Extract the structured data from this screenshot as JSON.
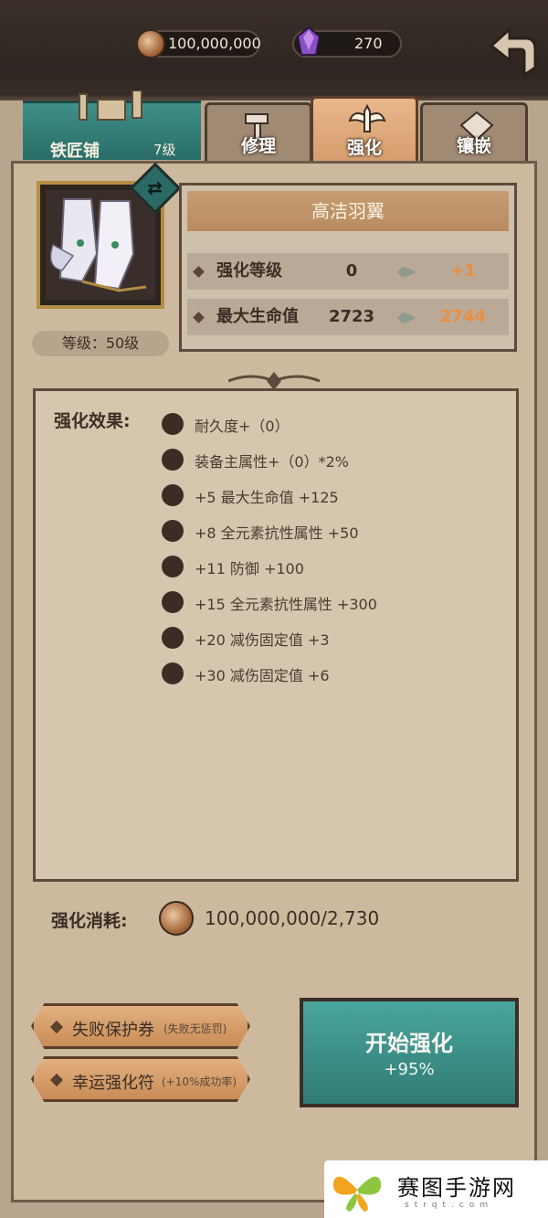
{
  "currency": {
    "gold": "100,000,000",
    "gold_icon": "coin-icon",
    "gem": "270",
    "gem_icon": "purple-gem-icon"
  },
  "shop": {
    "name": "铁匠铺",
    "level": "7级"
  },
  "tabs": [
    {
      "label": "修理",
      "icon": "hammer-icon",
      "active": false
    },
    {
      "label": "强化",
      "icon": "winged-sword-icon",
      "active": true
    },
    {
      "label": "镶嵌",
      "icon": "diamond-icon",
      "active": false
    }
  ],
  "item": {
    "name": "高洁羽翼",
    "level_text": "等级：50级",
    "stats": [
      {
        "label": "强化等级",
        "current": "0",
        "next": "+1"
      },
      {
        "label": "最大生命值",
        "current": "2723",
        "next": "2744"
      }
    ]
  },
  "effects": {
    "title": "强化效果:",
    "items": [
      "耐久度+（0）",
      "装备主属性+（0）*2%",
      "+5  最大生命值 +125",
      "+8  全元素抗性属性 +50",
      "+11  防御 +100",
      "+15  全元素抗性属性 +300",
      "+20  减伤固定值 +3",
      "+30  减伤固定值 +6"
    ]
  },
  "cost": {
    "label": "强化消耗:",
    "value": "100,000,000/2,730"
  },
  "buttons": {
    "protect": {
      "label": "失败保护券",
      "sub": "(失败无惩罚)"
    },
    "luck": {
      "label": "幸运强化符",
      "sub": "(+10%成功率)"
    },
    "start": {
      "label": "开始强化",
      "rate": "+95%"
    }
  },
  "watermark": {
    "text": "赛图手游网",
    "sub": "strqt.com"
  },
  "colors": {
    "accent_teal": "#3f8f88",
    "highlight_orange": "#e98f3f",
    "parchment": "#cdb99e"
  }
}
